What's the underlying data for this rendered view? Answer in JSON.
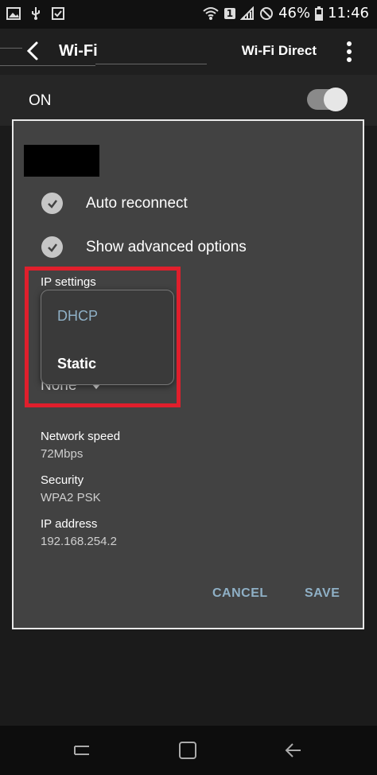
{
  "status_bar": {
    "battery": "46%",
    "time": "11:46",
    "sim_badge": "1"
  },
  "app_bar": {
    "title": "Wi-Fi",
    "action": "Wi-Fi Direct"
  },
  "wifi_toggle": {
    "label": "ON",
    "state": "on"
  },
  "dialog": {
    "options": [
      {
        "label": "Auto reconnect",
        "checked": true
      },
      {
        "label": "Show advanced options",
        "checked": true
      }
    ],
    "ip_settings": {
      "label": "IP settings",
      "dropdown_options": [
        "DHCP",
        "Static"
      ],
      "highlighted_option": "DHCP",
      "proxy_value": "None"
    },
    "info": [
      {
        "label": "Network speed",
        "value": "72Mbps"
      },
      {
        "label": "Security",
        "value": "WPA2 PSK"
      },
      {
        "label": "IP address",
        "value": "192.168.254.2"
      }
    ],
    "cancel_label": "CANCEL",
    "save_label": "SAVE"
  },
  "colors": {
    "accent": "#8fb0c6",
    "highlight_box": "#e01f2c",
    "dialog_bg": "#424242"
  }
}
